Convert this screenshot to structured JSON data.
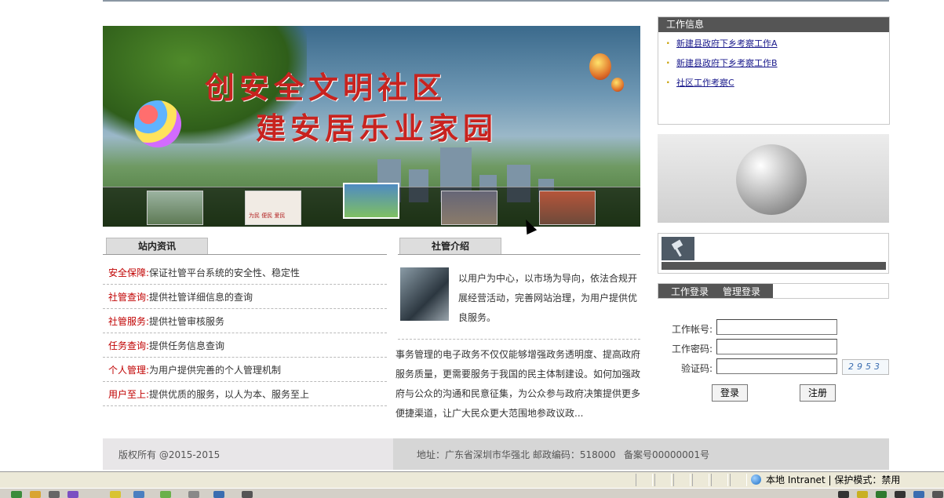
{
  "banner": {
    "line1": "创安全文明社区",
    "line2": "建安居乐业家园",
    "thumb_labels": [
      "为民 便民 爱民",
      "创安全文明社区 建安居乐业家园"
    ]
  },
  "work_info": {
    "title": "工作信息",
    "items": [
      "新建县政府下乡考察工作A",
      "新建县政府下乡考察工作B",
      "社区工作考察C"
    ]
  },
  "login": {
    "tab_work": "工作登录",
    "tab_admin": "管理登录",
    "account_label": "工作帐号:",
    "password_label": "工作密码:",
    "captcha_label": "验证码:",
    "captcha_value": "2953",
    "login_button": "登录",
    "register_button": "注册"
  },
  "site_news": {
    "title": "站内资讯",
    "rows": [
      {
        "key": "安全保障:",
        "value": "保证社管平台系统的安全性、稳定性"
      },
      {
        "key": "社管查询:",
        "value": "提供社管详细信息的查询"
      },
      {
        "key": "社管服务:",
        "value": "提供社管审核服务"
      },
      {
        "key": "任务查询:",
        "value": "提供任务信息查询"
      },
      {
        "key": "个人管理:",
        "value": "为用户提供完善的个人管理机制"
      },
      {
        "key": "用户至上:",
        "value": "提供优质的服务，以人为本、服务至上"
      }
    ]
  },
  "intro": {
    "title": "社管介绍",
    "summary": "以用户为中心，以市场为导向，依法合规开展经营活动，完善网站治理，为用户提供优良服务。",
    "more": "事务管理的电子政务不仅仅能够增强政务透明度、提高政府服务质量，更需要服务于我国的民主体制建设。如何加强政府与公众的沟通和民意征集，为公众参与政府决策提供更多便捷渠道，让广大民众更大范围地参政议政..."
  },
  "footer": {
    "copyright": "版权所有 @2015-2015",
    "address": "地址：广东省深圳市华强北 邮政编码：518000",
    "icp": "备案号00000001号"
  },
  "statusbar": {
    "zone": "本地 Intranet | 保护模式：禁用"
  },
  "colors": {
    "accent_red": "#c00000",
    "panel_dark": "#555555",
    "link_blue": "#1a1a8c"
  }
}
